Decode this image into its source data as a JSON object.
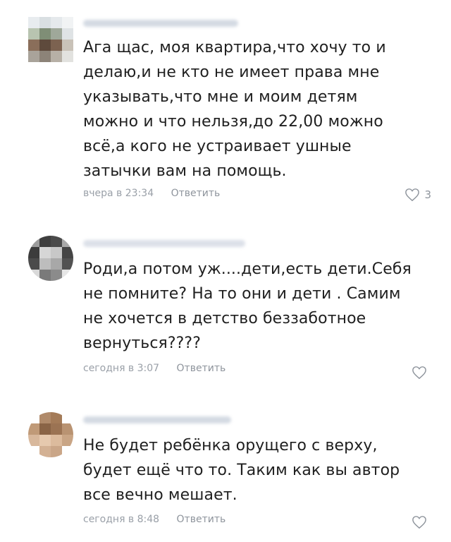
{
  "comments": [
    {
      "text": "Ага щас, моя квартира,что хочу то и\nделаю,и не кто не имеет права мне\nуказывать,что мне и моим детям\nможно и что нельзя,до 22,00 можно\nвсё,а кого не устраивает ушные\nзатычки вам на помощь.",
      "time": "вчера в 23:34",
      "reply": "Ответить",
      "likes": "3"
    },
    {
      "text": "Роди,а потом уж....дети,есть дети.Себя\nне помните?  На то они и дети . Самим\nне хочется в детство беззаботное\nвернуться????",
      "time": "сегодня в 3:07",
      "reply": "Ответить",
      "likes": ""
    },
    {
      "text": "Не будет ребёнка орущего с верху,\nбудет ещё что то. Таким как вы автор\nвсе вечно мешает.",
      "time": "сегодня в 8:48",
      "reply": "Ответить",
      "likes": ""
    }
  ],
  "colors": {
    "meta": "#9aa0a8",
    "heart": "#8e949c"
  },
  "icons": {
    "like": "heart-outline-icon"
  }
}
